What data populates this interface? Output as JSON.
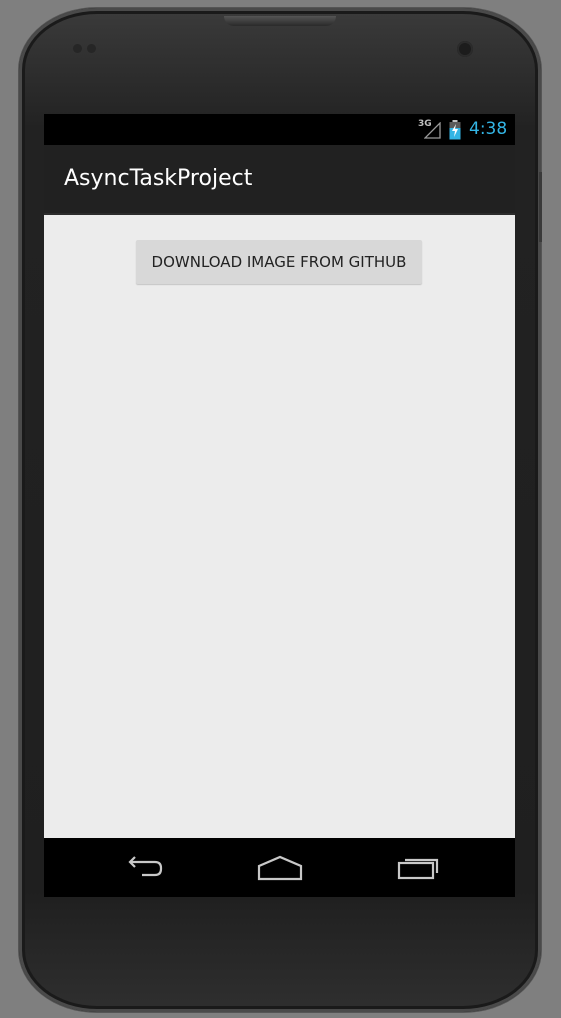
{
  "status_bar": {
    "network_type": "3G",
    "signal_icon": "signal-icon",
    "battery_icon": "battery-charging-icon",
    "time": "4:38"
  },
  "action_bar": {
    "title": "AsyncTaskProject"
  },
  "main": {
    "download_button_label": "DOWNLOAD IMAGE FROM GITHUB"
  },
  "nav_bar": {
    "back_icon": "back-icon",
    "home_icon": "home-icon",
    "recents_icon": "recent-apps-icon"
  },
  "colors": {
    "accent": "#33b5e5",
    "action_bar": "#212121",
    "content_background": "#ececec",
    "button_background": "#d8d8d8"
  }
}
